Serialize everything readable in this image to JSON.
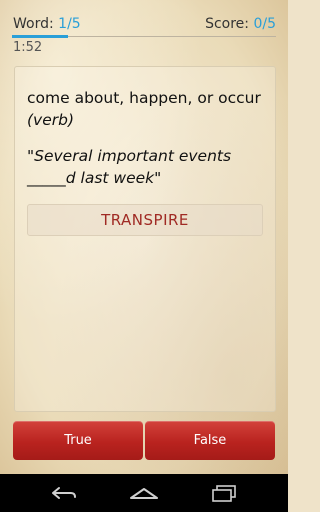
{
  "header": {
    "word_label": "Word: ",
    "word_progress": "1/5",
    "score_label": "Score: ",
    "score_progress": "0/5",
    "timer": "1:52"
  },
  "card": {
    "definition": "come about, happen, or occur",
    "part_of_speech": "(verb)",
    "example_line1": "\"Several important events",
    "example_line2": "_____d last week\"",
    "answer": "TRANSPIRE"
  },
  "buttons": {
    "true_label": "True",
    "false_label": "False"
  },
  "navbar": {
    "icons": [
      "back-icon",
      "home-icon",
      "recent-apps-icon"
    ]
  },
  "colors": {
    "accent": "#2a9fd8",
    "answer_text": "#a02a24",
    "button_red": "#b9231f"
  }
}
